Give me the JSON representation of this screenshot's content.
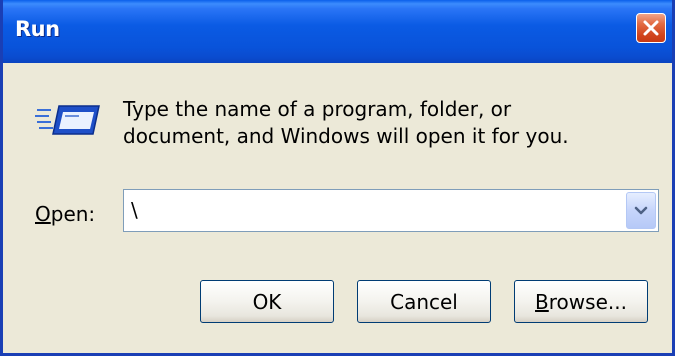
{
  "window": {
    "title": "Run",
    "close_icon": "close-icon"
  },
  "description": {
    "line1": "Type the name of a program, folder, or",
    "line2": "document, and Windows will open it for you.",
    "icon": "run-icon"
  },
  "open_field": {
    "label_accel": "O",
    "label_rest": "pen:",
    "value": "\\",
    "dropdown_icon": "chevron-down-icon"
  },
  "buttons": {
    "ok": "OK",
    "cancel": "Cancel",
    "browse_accel": "B",
    "browse_rest": "rowse..."
  },
  "colors": {
    "title_bar": "#0A5FEA",
    "dialog_bg": "#ECE9D8",
    "close_button": "#E26B43"
  }
}
